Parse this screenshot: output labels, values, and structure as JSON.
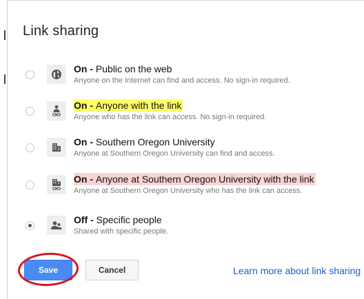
{
  "dialog": {
    "title": "Link sharing"
  },
  "options": [
    {
      "status": "On",
      "label": "Public on the web",
      "description": "Anyone on the Internet can find and access. No sign-in required.",
      "icon": "globe-icon",
      "selected": false
    },
    {
      "status": "On",
      "label": "Anyone with the link",
      "description": "Anyone who has the link can access. No sign-in required.",
      "icon": "person-link-icon",
      "selected": false,
      "highlight": "#ffff66"
    },
    {
      "status": "On",
      "label": "Southern Oregon University",
      "description": "Anyone at Southern Oregon University can find and access.",
      "icon": "building-icon",
      "selected": false
    },
    {
      "status": "On",
      "label": "Anyone at Southern Oregon University with the link",
      "description": "Anyone at Southern Oregon University who has the link can access.",
      "icon": "building-link-icon",
      "selected": false,
      "highlight": "#f9d4d4"
    },
    {
      "status": "Off",
      "label": "Specific people",
      "description": "Shared with specific people.",
      "icon": "people-icon",
      "selected": true
    }
  ],
  "buttons": {
    "save": "Save",
    "cancel": "Cancel"
  },
  "links": {
    "learn_more": "Learn more about link sharing"
  },
  "colors": {
    "primary_button": "#4a8af4",
    "link": "#1a5fc9",
    "annotation_ring": "#d9141e"
  }
}
